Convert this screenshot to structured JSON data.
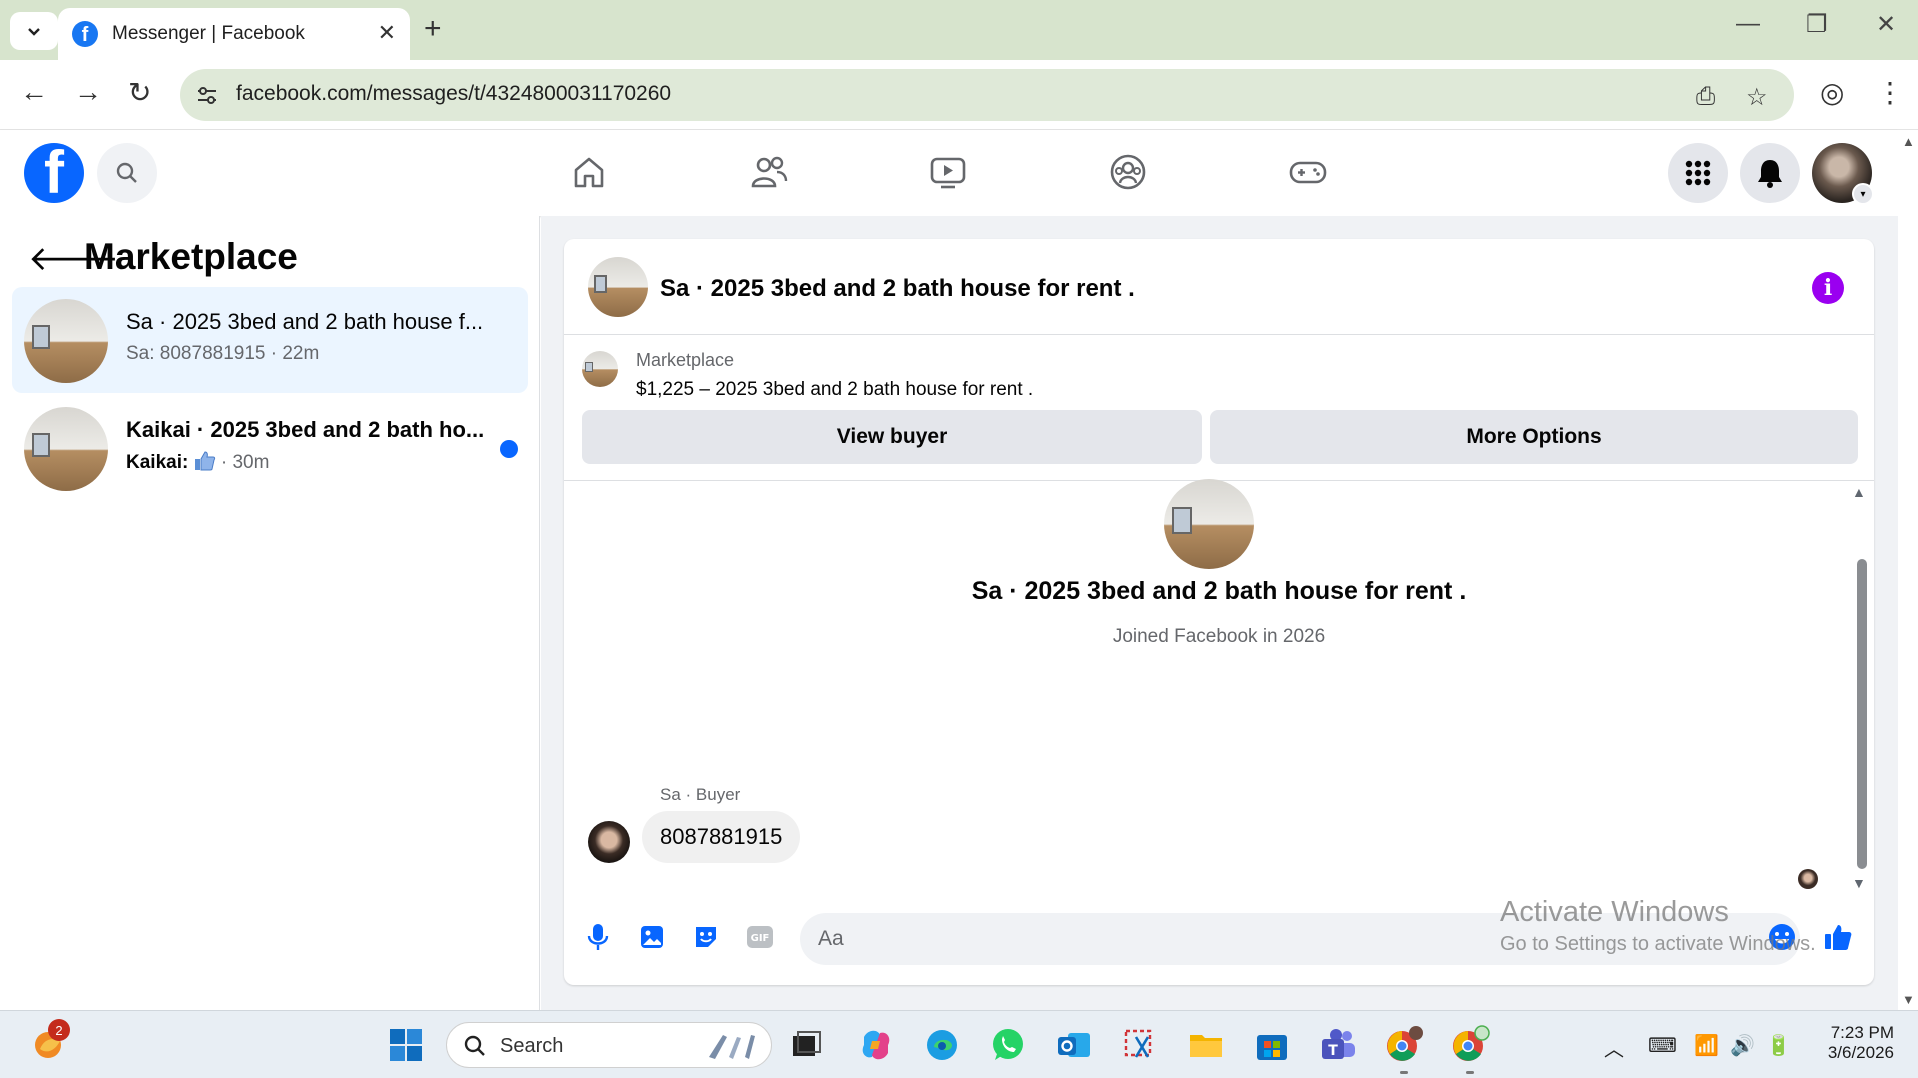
{
  "browser": {
    "tab_title": "Messenger | Facebook",
    "tab_close": "✕",
    "new_tab": "+",
    "url": "facebook.com/messages/t/4324800031170260"
  },
  "left_panel": {
    "title": "Marketplace",
    "conversations": [
      {
        "name": "Sa · 2025 3bed and 2 bath house f...",
        "preview": "Sa: 8087881915 · 22m",
        "active": true,
        "unread": false
      },
      {
        "name": "Kaikai · 2025 3bed and 2 bath ho...",
        "preview_sender": "Kaikai:",
        "preview_time": "· 30m",
        "active": false,
        "unread": true
      }
    ]
  },
  "chat": {
    "header_title": "Sa · 2025 3bed and 2 bath house for rent .",
    "marketplace_label": "Marketplace",
    "listing": "$1,225 – 2025 3bed and 2 bath house for rent .",
    "buttons": {
      "view_buyer": "View buyer",
      "more_options": "More Options"
    },
    "profile_name": "Sa · 2025 3bed and 2 bath house for rent .",
    "profile_joined": "Joined Facebook in 2026",
    "sender_label": "Sa · Buyer",
    "message": "8087881915",
    "composer_placeholder": "Aa"
  },
  "watermark": {
    "line1": "Activate Windows",
    "line2": "Go to Settings to activate Windows."
  },
  "taskbar": {
    "search_text": "Search",
    "badge_count": "2",
    "time": "7:23 PM",
    "date": "3/6/2026"
  },
  "colors": {
    "facebook_blue": "#0866ff",
    "active_conversation_bg": "#ebf5ff",
    "info_icon_purple": "#9a00f0"
  }
}
